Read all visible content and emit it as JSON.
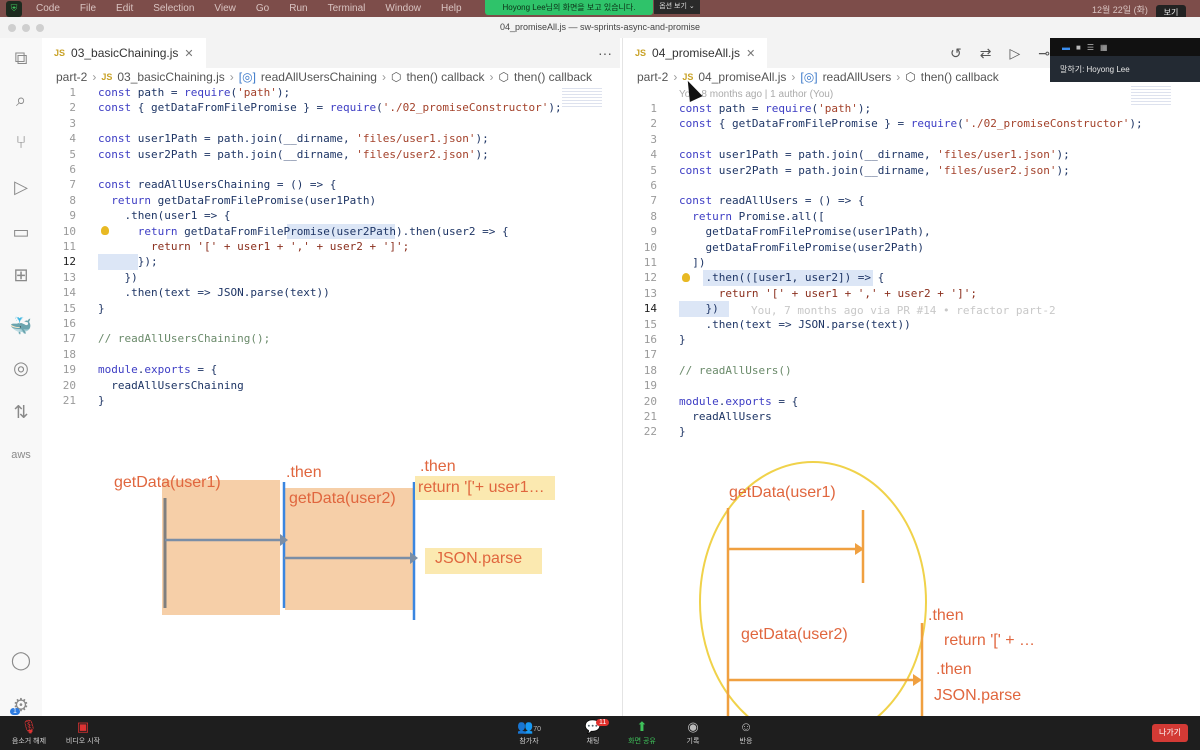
{
  "menubar": {
    "items": [
      "Code",
      "File",
      "Edit",
      "Selection",
      "View",
      "Go",
      "Run",
      "Terminal",
      "Window",
      "Help"
    ],
    "clock": "12월 22일 (화)",
    "view_label": "보기"
  },
  "zoom_share": {
    "banner": "Hoyong Lee님의 화면을 보고 있습니다.",
    "options": "옵션 보기 ⌄",
    "speaker": "말하기: Hoyong Lee"
  },
  "window": {
    "title": "04_promiseAll.js — sw-sprints-async-and-promise"
  },
  "activity_icons": [
    "files-icon",
    "search-icon",
    "source-control-icon",
    "run-debug-icon",
    "remote-explorer-icon",
    "extensions-icon",
    "docker-icon",
    "gitlens-icon",
    "pull-request-icon",
    "aws-icon",
    "account-icon",
    "settings-icon"
  ],
  "activity_glyphs": [
    "⧉",
    "⌕",
    "⑂",
    "▷",
    "▭",
    "⊞",
    "🐳",
    "◎",
    "⇅",
    "aws",
    "◯",
    "⚙"
  ],
  "left": {
    "tab": "03_basicChaining.js",
    "more": "···",
    "crumbs": [
      "part-2",
      "03_basicChaining.js",
      "readAllUsersChaining",
      "then() callback",
      "then() callback"
    ],
    "current_line": 12,
    "code": [
      "const path = require('path');",
      "const { getDataFromFilePromise } = require('./02_promiseConstructor');",
      "",
      "const user1Path = path.join(__dirname, 'files/user1.json');",
      "const user2Path = path.join(__dirname, 'files/user2.json');",
      "",
      "const readAllUsersChaining = () => {",
      "  return getDataFromFilePromise(user1Path)",
      "    .then(user1 => {",
      "      return getDataFromFilePromise(user2Path).then(user2 => {",
      "        return '[' + user1 + ',' + user2 + ']';",
      "      });",
      "    })",
      "    .then(text => JSON.parse(text))",
      "}",
      "",
      "// readAllUsersChaining();",
      "",
      "module.exports = {",
      "  readAllUsersChaining",
      "}"
    ],
    "drawing": {
      "a": "getData(user1)",
      "b": ".then",
      "c": "getData(user2)",
      "d": ".then",
      "e": "return '['+ user1…",
      "f": "JSON.parse"
    }
  },
  "right": {
    "tab": "04_promiseAll.js",
    "crumbs": [
      "part-2",
      "04_promiseAll.js",
      "readAllUsers",
      "then() callback"
    ],
    "blame_header": "You, 8 months ago | 1 author (You)",
    "inline_blame": "You, 7 months ago via PR #14 • refactor part-2",
    "current_line": 14,
    "code": [
      "const path = require('path');",
      "const { getDataFromFilePromise } = require('./02_promiseConstructor');",
      "",
      "const user1Path = path.join(__dirname, 'files/user1.json');",
      "const user2Path = path.join(__dirname, 'files/user2.json');",
      "",
      "const readAllUsers = () => {",
      "  return Promise.all([",
      "    getDataFromFilePromise(user1Path),",
      "    getDataFromFilePromise(user2Path)",
      "  ])",
      "    .then(([user1, user2]) => {",
      "      return '[' + user1 + ',' + user2 + ']';",
      "    })",
      "    .then(text => JSON.parse(text))",
      "}",
      "",
      "// readAllUsers()",
      "",
      "module.exports = {",
      "  readAllUsers",
      "}"
    ],
    "drawing": {
      "a": "getData(user1)",
      "b": "getData(user2)",
      "c": ".then",
      "d": "return '[' + …",
      "e": ".then",
      "f": "JSON.parse"
    }
  },
  "toolbar": {
    "unmute": "음소거 해제",
    "video": "비디오 시작",
    "participants": "참가자",
    "participants_count": "70",
    "chat": "채팅",
    "chat_badge": "11",
    "share": "화면 공유",
    "record": "기록",
    "reactions": "반응",
    "leave": "나가기",
    "settings_badge": "1"
  },
  "colors": {
    "accent_orange": "#e0663e",
    "share_green": "#2fc36a",
    "leave_red": "#d33a35"
  }
}
